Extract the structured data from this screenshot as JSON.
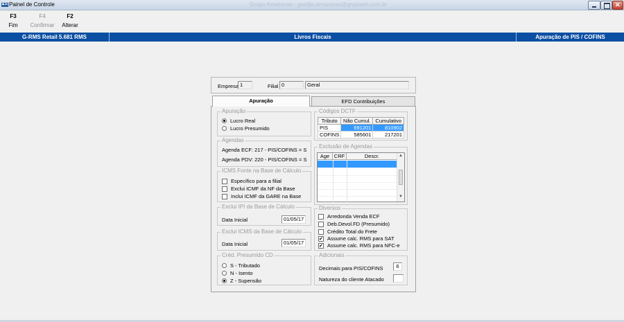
{
  "window": {
    "title": "Painel de Controle",
    "blurred_title": "Grupo Amazonas - gestão.amazonas@grupoam.com.br"
  },
  "toolbar": [
    {
      "key": "F3",
      "label": "Fim",
      "enabled": true
    },
    {
      "key": "F4",
      "label": "Confirmar",
      "enabled": false
    },
    {
      "key": "F2",
      "label": "Alterar",
      "enabled": true
    }
  ],
  "header": {
    "left": "G-RMS Retail 5.681 RMS",
    "center": "Livros Fiscais",
    "right": "Apuração de PIS / COFINS"
  },
  "empresa": {
    "label": "Empresa",
    "value": "1"
  },
  "filial": {
    "label": "Filial",
    "value": "0",
    "name": "Geral"
  },
  "tabs": {
    "active": "Apuração",
    "other": "EFD Contribuições"
  },
  "apuracao": {
    "legend": "Apuração",
    "options": [
      "Lucro Real",
      "Lucro Presumido"
    ],
    "selected": "Lucro Real"
  },
  "agendas": {
    "legend": "Agendas",
    "ecf": "Agenda ECF: 217 - PIS/COFINS = S",
    "pdv": "Agenda PDV: 220 - PIS/COFINS = S"
  },
  "icms_fonte": {
    "legend": "ICMS Fonte na Base de Cálculo",
    "items": [
      {
        "label": "Específico para a filial",
        "checked": false
      },
      {
        "label": "Exclui ICMF da NF da Base",
        "checked": false
      },
      {
        "label": "Inclui ICMF da GARE na Base",
        "checked": false
      }
    ]
  },
  "exclui_ipi": {
    "legend": "Exclui IPI da Base de Cálculo",
    "label": "Data Inicial",
    "value": "01/05/17"
  },
  "exclui_icms": {
    "legend": "Exclui ICMS da Base de Cálculo",
    "label": "Data Inicial",
    "value": "01/05/17"
  },
  "cred_presumido": {
    "legend": "Créd. Presumido CD",
    "options": [
      "S - Tributado",
      "N - Isento",
      "Z - Supensão"
    ],
    "selected": "Z - Supensão"
  },
  "codigos_dctf": {
    "legend": "Códigos DCTF",
    "columns": [
      "Tributo",
      "Não Cumul.",
      "Cumulativo"
    ],
    "rows": [
      [
        "PIS",
        "691201",
        "810902"
      ],
      [
        "COFINS",
        "585601",
        "217201"
      ]
    ]
  },
  "exclusao_agendas": {
    "legend": "Exclusão de Agendas",
    "columns": [
      "Age",
      "CRF",
      "Descr."
    ]
  },
  "diversos": {
    "legend": "Diversos",
    "items": [
      {
        "label": "Arredonda Venda ECF",
        "checked": false
      },
      {
        "label": "Deb.Devol.FD (Presumido)",
        "checked": false
      },
      {
        "label": "Crédito Total do Frete",
        "checked": false
      },
      {
        "label": "Assume calc. RMS para SAT",
        "checked": true
      },
      {
        "label": "Assume calc. RMS para NFC-e",
        "checked": true
      }
    ]
  },
  "adicionais": {
    "legend": "Adicionais",
    "decimais_label": "Decimais para PIS/COFINS",
    "decimais_value": "6",
    "natureza_label": "Natureza do cliente Atacado",
    "natureza_value": ""
  }
}
